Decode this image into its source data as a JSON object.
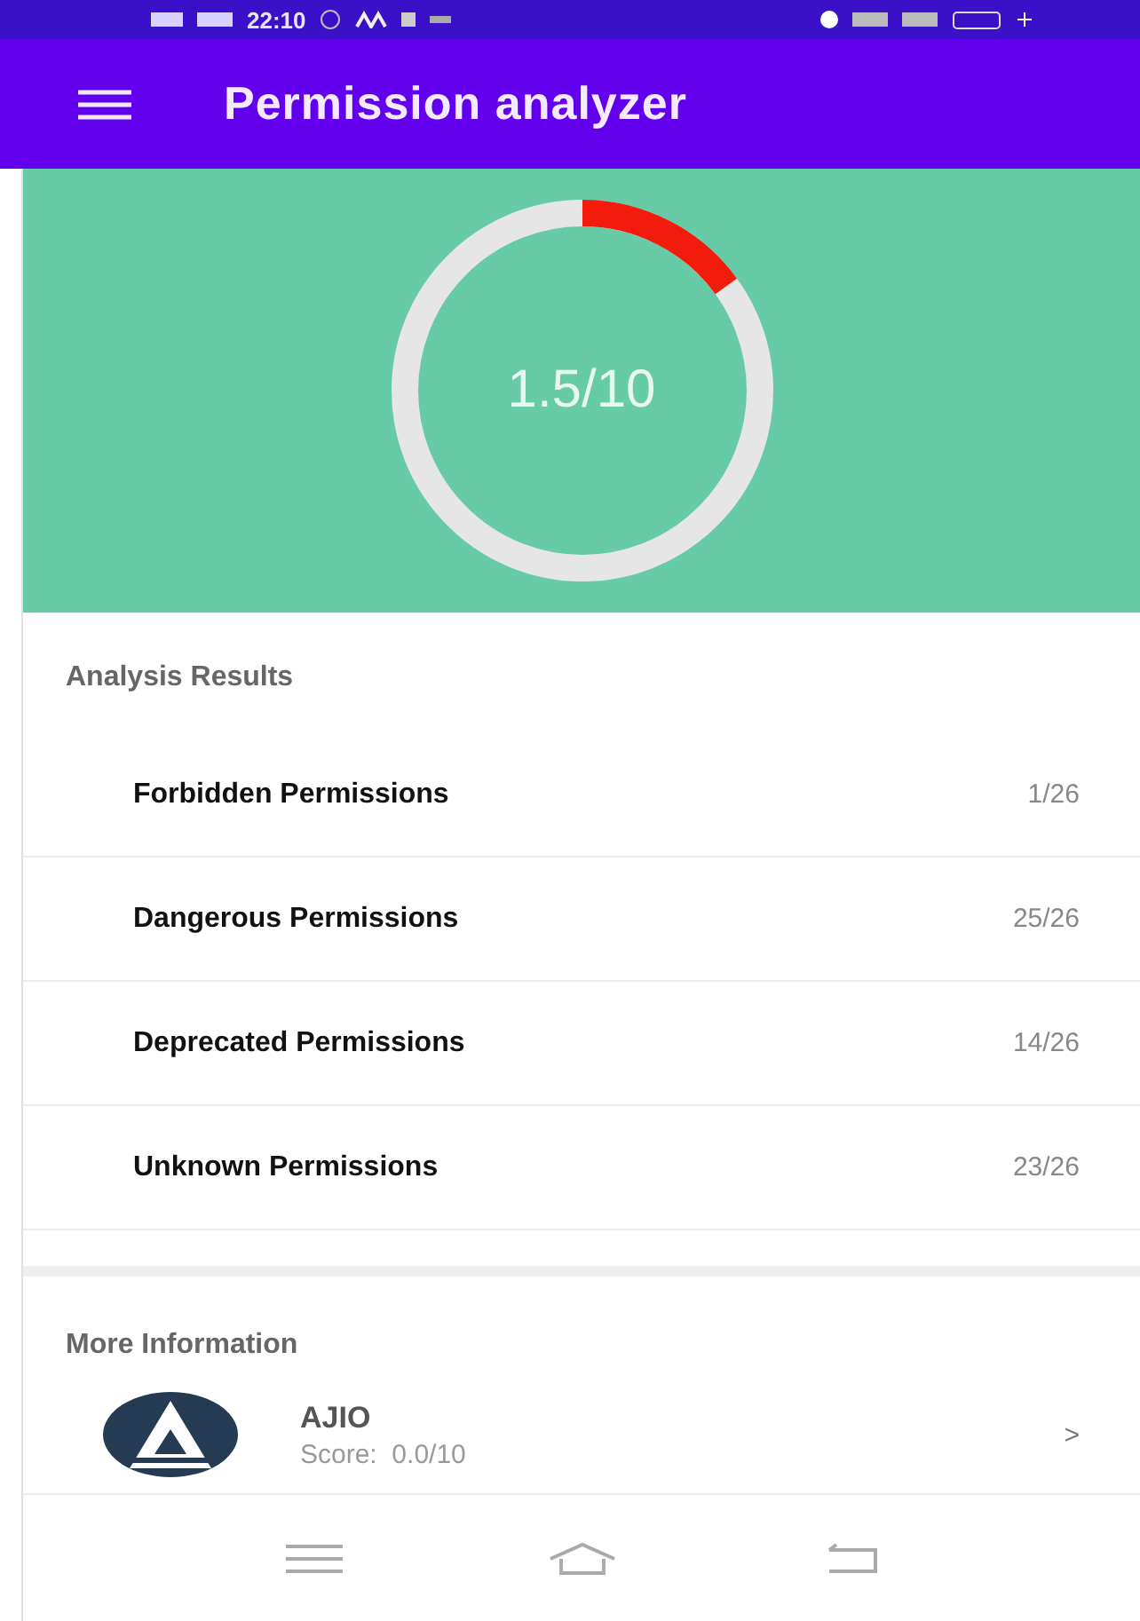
{
  "status_bar": {
    "time": "22:10"
  },
  "app_bar": {
    "title": "Permission analyzer"
  },
  "score": {
    "text": "1.5/10",
    "level": 0.15
  },
  "analysis": {
    "heading": "Analysis Results",
    "rows": [
      {
        "label": "Forbidden Permissions",
        "count": "1/26"
      },
      {
        "label": "Dangerous Permissions",
        "count": "25/26"
      },
      {
        "label": "Deprecated Permissions",
        "count": "14/26"
      },
      {
        "label": "Unknown Permissions",
        "count": "23/26"
      }
    ]
  },
  "more_info": {
    "heading": "More Information",
    "apps": [
      {
        "name": "AJIO",
        "score": "Score:  0.0/10",
        "chevron": ">"
      }
    ]
  }
}
